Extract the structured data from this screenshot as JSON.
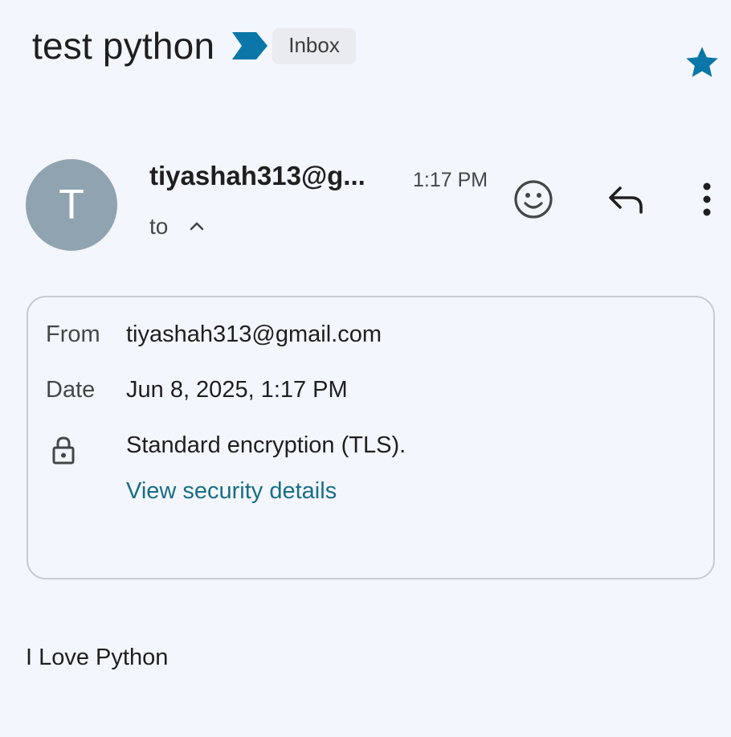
{
  "email": {
    "subject": "test python",
    "label": "Inbox",
    "starred": true,
    "sender_initial": "T",
    "sender_truncated": "tiyashah313@g...",
    "time": "1:17 PM",
    "to_label": "to",
    "body": "I Love Python"
  },
  "details": {
    "from_label": "From",
    "from_value": "tiyashah313@gmail.com",
    "date_label": "Date",
    "date_value": "Jun 8, 2025, 1:17 PM",
    "encryption": "Standard encryption (TLS).",
    "security_link": "View security details"
  },
  "icons": {
    "importance": "importance-marker-icon",
    "star": "star-icon",
    "chevron": "chevron-up-icon",
    "emoji": "emoji-react-icon",
    "reply": "reply-icon",
    "more": "more-vert-icon",
    "lock": "lock-icon"
  },
  "colors": {
    "background": "#f3f6fc",
    "accent": "#0b77a8",
    "avatar": "#8fa3b1",
    "link": "#1a6e86",
    "chip": "#e9ebee"
  }
}
